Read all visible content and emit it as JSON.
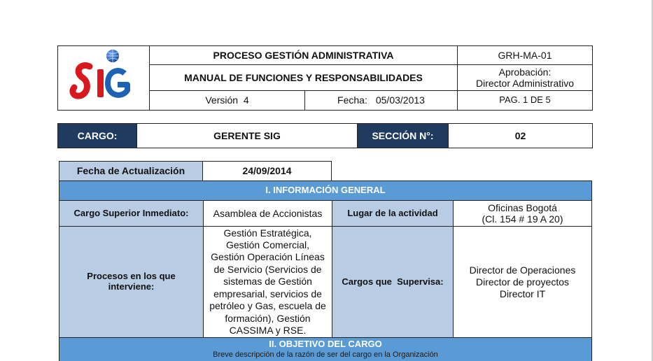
{
  "header": {
    "process_title": "PROCESO GESTIÓN ADMINISTRATIVA",
    "manual_title": "MANUAL DE FUNCIONES Y RESPONSABILIDADES",
    "code": "GRH-MA-01",
    "approval_label": "Aprobación:",
    "approval_value": "Director Administrativo",
    "version": "Versión  4",
    "date_label": "Fecha:",
    "date_value": "05/03/2013",
    "page": "PAG. 1 DE 5",
    "logo_text": "SIG"
  },
  "cargo": {
    "label": "CARGO:",
    "value": "GERENTE SIG",
    "section_label": "SECCIÓN N°:",
    "section_value": "02"
  },
  "update": {
    "label": "Fecha de Actualización",
    "value": "24/09/2014"
  },
  "general": {
    "title": "I. INFORMACIÓN GENERAL",
    "superior_label": "Cargo Superior Inmediato:",
    "superior_value": "Asamblea de Accionistas",
    "location_label": "Lugar de la actividad",
    "location_value_1": "Oficinas Bogotá",
    "location_value_2": "(Cl. 154 # 19 A 20)",
    "processes_label_1": "Procesos en los que",
    "processes_label_2": "interviene:",
    "processes_lines": [
      "Gestión Estratégica,",
      "Gestión Comercial,",
      "Gestión Operación Líneas",
      "de Servicio (Servicios de",
      "sistemas de Gestión",
      "empresarial, servicios de",
      "petróleo y Gas, escuela de",
      "formación), Gestión",
      "CASSIMA y RSE."
    ],
    "supervises_label": "Cargos que  Supervisa:",
    "supervises_lines": [
      "Director de Operaciones",
      "Director de proyectos",
      "Director IT"
    ]
  },
  "objective": {
    "title": "II. OBJETIVO DEL CARGO",
    "subtitle": "Breve descripción de la razón de ser del cargo en la Organización"
  },
  "colors": {
    "navy": "#1f3b5f",
    "light_blue": "#b8cce4",
    "mid_blue": "#5b9bd5",
    "logo_red": "#d7181f",
    "logo_blue": "#1d62b4"
  }
}
